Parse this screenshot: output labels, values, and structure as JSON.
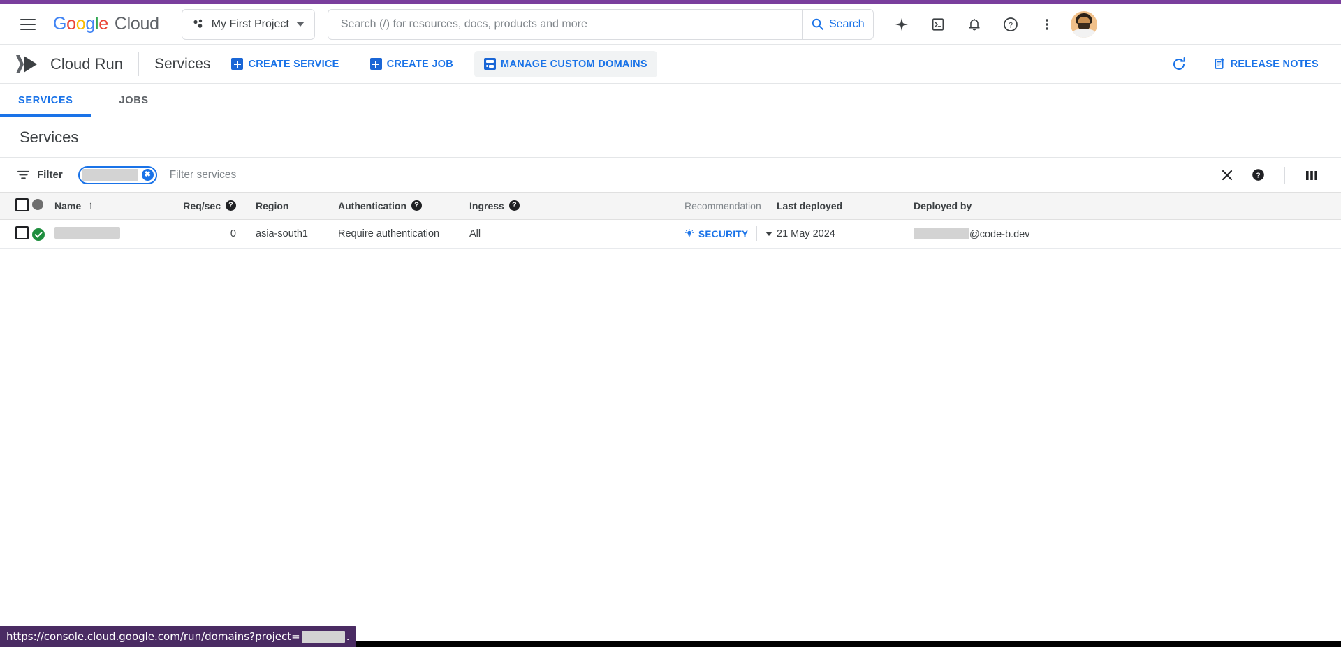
{
  "header": {
    "menu_icon": "hamburger-menu-icon",
    "brand": {
      "g": "G",
      "o1": "o",
      "o2": "o",
      "g2": "g",
      "l": "l",
      "e": "e",
      "cloud": "Cloud"
    },
    "project_selector": {
      "label": "My First Project",
      "icon": "project-dots-icon"
    },
    "search": {
      "placeholder": "Search (/) for resources, docs, products and more",
      "value": "",
      "button_label": "Search",
      "icon": "search-icon"
    },
    "icons": [
      {
        "name": "gemini-spark-icon",
        "glyph": "✦"
      },
      {
        "name": "cloud-shell-icon",
        "glyph": ">_"
      },
      {
        "name": "notifications-bell-icon",
        "glyph": "␇"
      },
      {
        "name": "help-question-icon",
        "glyph": "?"
      },
      {
        "name": "more-options-icon",
        "glyph": "⋮"
      }
    ],
    "avatar": "user-avatar"
  },
  "product_bar": {
    "logo": "cloud-run-logo",
    "product_title": "Cloud Run",
    "page_label": "Services",
    "buttons": [
      {
        "name": "create-service-button",
        "label": "CREATE SERVICE",
        "icon": "plus-icon",
        "active": false
      },
      {
        "name": "create-job-button",
        "label": "CREATE JOB",
        "icon": "plus-icon",
        "active": false
      },
      {
        "name": "manage-custom-domains-button",
        "label": "MANAGE CUSTOM DOMAINS",
        "icon": "domains-icon",
        "active": true
      }
    ],
    "refresh_label": "refresh-icon",
    "release_notes_label": "RELEASE NOTES"
  },
  "tabs": [
    {
      "name": "tab-services",
      "label": "SERVICES",
      "selected": true
    },
    {
      "name": "tab-jobs",
      "label": "JOBS",
      "selected": false
    }
  ],
  "page_title": "Services",
  "filter_bar": {
    "label": "Filter",
    "filter_icon": "filter-icon",
    "chip": {
      "redacted": true,
      "remove_icon": "chip-close-icon"
    },
    "placeholder": "Filter services",
    "clear_icon": "close-icon",
    "help_icon": "help-icon",
    "columns_icon": "column-display-options-icon"
  },
  "table": {
    "columns": [
      {
        "key": "checkbox",
        "label": "",
        "icon": "select-all-checkbox",
        "help": false,
        "muted": false
      },
      {
        "key": "status",
        "label": "",
        "icon": "status-dot-icon",
        "help": false,
        "muted": false
      },
      {
        "key": "name",
        "label": "Name",
        "sorted": "asc",
        "help": false,
        "muted": false
      },
      {
        "key": "req_sec",
        "label": "Req/sec",
        "help": true,
        "muted": false
      },
      {
        "key": "region",
        "label": "Region",
        "help": false,
        "muted": false
      },
      {
        "key": "authentication",
        "label": "Authentication",
        "help": true,
        "muted": false
      },
      {
        "key": "ingress",
        "label": "Ingress",
        "help": true,
        "muted": false
      },
      {
        "key": "recommendation",
        "label": "Recommendation",
        "help": false,
        "muted": true
      },
      {
        "key": "last_deployed",
        "label": "Last deployed",
        "help": false,
        "muted": false
      },
      {
        "key": "deployed_by",
        "label": "Deployed by",
        "help": false,
        "muted": false
      }
    ],
    "rows": [
      {
        "status": "ok",
        "name_redacted": true,
        "req_sec": "0",
        "region": "asia-south1",
        "authentication": "Require authentication",
        "ingress": "All",
        "recommendation": "SECURITY",
        "last_deployed": "21 May 2024",
        "deployed_by_suffix": "@code-b.dev"
      }
    ]
  },
  "status_bar": {
    "url_prefix": "https://console.cloud.google.com/run/domains?project=",
    "url_suffix": "."
  },
  "colors": {
    "purple_strip": "#7a3e9d",
    "accent_blue": "#1a73e8",
    "status_green": "#1e8e3e",
    "tooltip_purple": "#4a2b63"
  }
}
